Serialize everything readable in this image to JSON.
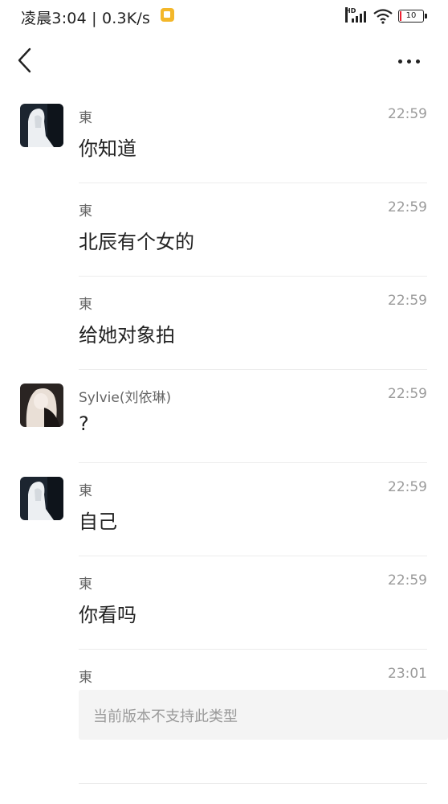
{
  "status_bar": {
    "time_speed": "凌晨3:04 | 0.3K/s",
    "network": "HD",
    "battery": "10",
    "notification_color": "#f3b72a"
  },
  "nav": {
    "back_icon": "chevron-left-icon",
    "more_icon": "more-dots-icon"
  },
  "messages": [
    {
      "sender": "東",
      "time": "22:59",
      "text": "你知道",
      "avatar": "avatar-dong"
    },
    {
      "sender": "東",
      "time": "22:59",
      "text": "北辰有个女的"
    },
    {
      "sender": "東",
      "time": "22:59",
      "text": "给她对象拍"
    },
    {
      "sender": "Sylvie(刘依琳)",
      "time": "22:59",
      "text": "?",
      "avatar": "avatar-sylvie"
    },
    {
      "sender": "東",
      "time": "22:59",
      "text": "自己",
      "avatar": "avatar-dong"
    },
    {
      "sender": "東",
      "time": "22:59",
      "text": "你看吗"
    },
    {
      "sender": "東",
      "time": "23:01",
      "unsupported": "当前版本不支持此类型"
    }
  ]
}
